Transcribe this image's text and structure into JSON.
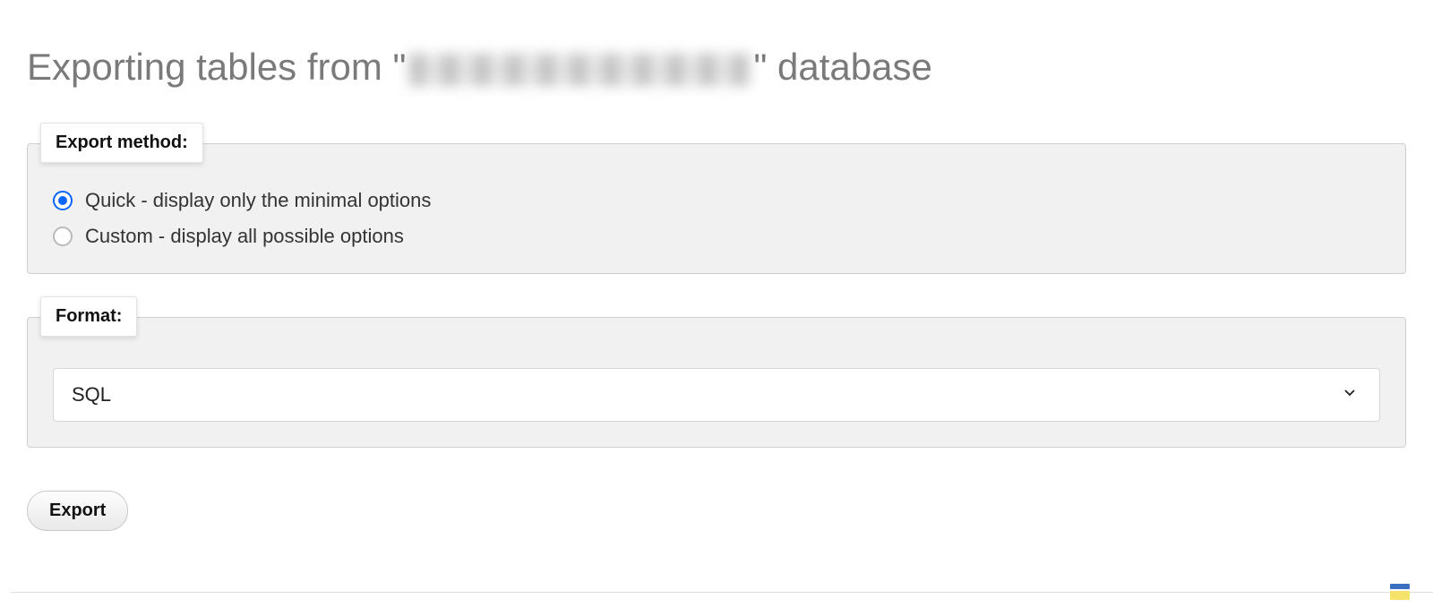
{
  "page": {
    "title_prefix": "Exporting tables from \"",
    "title_suffix": "\" database"
  },
  "export_method": {
    "legend": "Export method:",
    "options": [
      {
        "label": "Quick - display only the minimal options",
        "selected": true
      },
      {
        "label": "Custom - display all possible options",
        "selected": false
      }
    ]
  },
  "format": {
    "legend": "Format:",
    "selected": "SQL"
  },
  "actions": {
    "export": "Export"
  }
}
